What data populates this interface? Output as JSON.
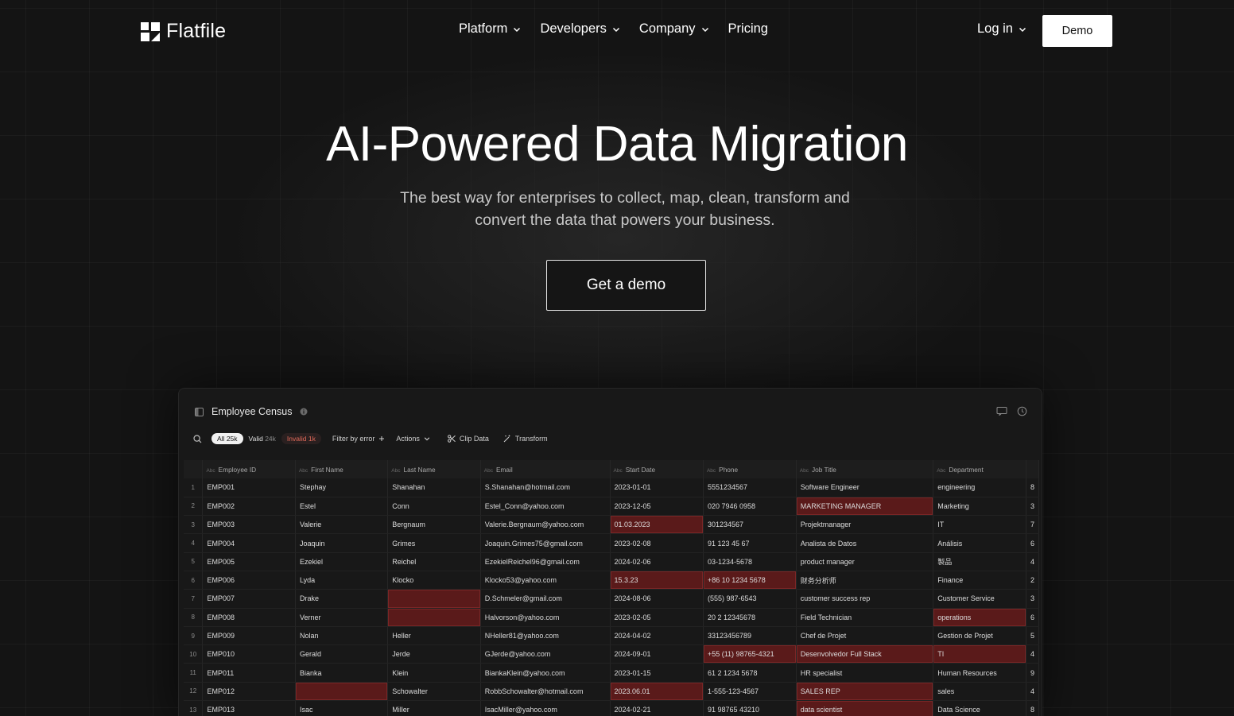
{
  "nav": {
    "brand": "Flatfile",
    "menu": [
      {
        "label": "Platform",
        "dropdown": true
      },
      {
        "label": "Developers",
        "dropdown": true
      },
      {
        "label": "Company",
        "dropdown": true
      },
      {
        "label": "Pricing",
        "dropdown": false
      }
    ],
    "login_label": "Log in",
    "demo_label": "Demo"
  },
  "hero": {
    "title": "AI-Powered Data Migration",
    "subtitle": "The best way for enterprises to collect, map, clean, transform and convert the data that powers your business.",
    "cta_label": "Get a demo"
  },
  "app": {
    "sheet_title": "Employee Census",
    "filters": {
      "all_label": "All",
      "all_count": "25k",
      "valid_label": "Valid",
      "valid_count": "24k",
      "invalid_label": "Invalid",
      "invalid_count": "1k"
    },
    "tools": {
      "filter_by_error": "Filter by error",
      "actions": "Actions",
      "clip_data": "Clip Data",
      "transform": "Transform"
    },
    "type_tag": "Abc",
    "columns": [
      "Employee ID",
      "First Name",
      "Last Name",
      "Email",
      "Start Date",
      "Phone",
      "Job Title",
      "Department",
      ""
    ],
    "rows": [
      {
        "n": "1",
        "cells": [
          "EMP001",
          "Stephay",
          "Shanahan",
          "S.Shanahan@hotmail.com",
          "2023-01-01",
          "5551234567",
          "Software Engineer",
          "engineering",
          "8"
        ],
        "errors": []
      },
      {
        "n": "2",
        "cells": [
          "EMP002",
          "Estel",
          "Conn",
          "Estel_Conn@yahoo.com",
          "2023-12-05",
          "020 7946 0958",
          "MARKETING MANAGER",
          "Marketing",
          "3"
        ],
        "errors": [
          6
        ]
      },
      {
        "n": "3",
        "cells": [
          "EMP003",
          "Valerie",
          "Bergnaum",
          "Valerie.Bergnaum@yahoo.com",
          "01.03.2023",
          "301234567",
          "Projektmanager",
          "IT",
          "7"
        ],
        "errors": [
          4
        ]
      },
      {
        "n": "4",
        "cells": [
          "EMP004",
          "Joaquin",
          "Grimes",
          "Joaquin.Grimes75@gmail.com",
          "2023-02-08",
          "91 123 45 67",
          "Analista de Datos",
          "Análisis",
          "6"
        ],
        "errors": []
      },
      {
        "n": "5",
        "cells": [
          "EMP005",
          "Ezekiel",
          "Reichel",
          "EzekielReichel96@gmail.com",
          "2024-02-06",
          "03-1234-5678",
          "product manager",
          "製品",
          "4"
        ],
        "errors": []
      },
      {
        "n": "6",
        "cells": [
          "EMP006",
          "Lyda",
          "Klocko",
          "Klocko53@yahoo.com",
          "15.3.23",
          "+86 10 1234 5678",
          "财务分析师",
          "Finance",
          "2"
        ],
        "errors": [
          4,
          5
        ]
      },
      {
        "n": "7",
        "cells": [
          "EMP007",
          "Drake",
          "",
          "D.Schmeler@gmail.com",
          "2024-08-06",
          "(555) 987-6543",
          "customer success rep",
          "Customer Service",
          "3"
        ],
        "errors": [
          2
        ]
      },
      {
        "n": "8",
        "cells": [
          "EMP008",
          "Verner",
          "",
          "Halvorson@yahoo.com",
          "2023-02-05",
          "20 2 12345678",
          "Field Technician",
          "operations",
          "6"
        ],
        "errors": [
          2,
          7
        ]
      },
      {
        "n": "9",
        "cells": [
          "EMP009",
          "Nolan",
          "Heller",
          "NHeller81@yahoo.com",
          "2024-04-02",
          "33123456789",
          "Chef de Projet",
          "Gestion de Projet",
          "5"
        ],
        "errors": []
      },
      {
        "n": "10",
        "cells": [
          "EMP010",
          "Gerald",
          "Jerde",
          "GJerde@yahoo.com",
          "2024-09-01",
          "+55 (11) 98765-4321",
          "Desenvolvedor Full Stack",
          "TI",
          "4"
        ],
        "errors": [
          5,
          6,
          7
        ]
      },
      {
        "n": "11",
        "cells": [
          "EMP011",
          "Bianka",
          "Klein",
          "BiankaKlein@yahoo.com",
          "2023-01-15",
          "61 2 1234 5678",
          "HR specialist",
          "Human Resources",
          "9"
        ],
        "errors": []
      },
      {
        "n": "12",
        "cells": [
          "EMP012",
          "",
          "Schowalter",
          "RobbSchowalter@hotmail.com",
          "2023.06.01",
          "1-555-123-4567",
          "SALES REP",
          "sales",
          "4"
        ],
        "errors": [
          1,
          4,
          6
        ]
      },
      {
        "n": "13",
        "cells": [
          "EMP013",
          "Isac",
          "Miller",
          "IsacMiller@yahoo.com",
          "2024-02-21",
          "91 98765 43210",
          "data scientist",
          "Data Science",
          "8"
        ],
        "errors": [
          6
        ]
      }
    ]
  },
  "colors": {
    "background": "#141414",
    "error_cell": "#5a1a1a",
    "invalid_text": "#e26a5a",
    "primary_button": "#ffffff"
  },
  "icons": [
    "flatfile-logo-icon",
    "chevron-down-icon",
    "sidebar-toggle-icon",
    "info-icon",
    "search-icon",
    "plus-icon",
    "scissors-icon",
    "magic-wand-icon",
    "bookmark-icon",
    "history-icon"
  ]
}
